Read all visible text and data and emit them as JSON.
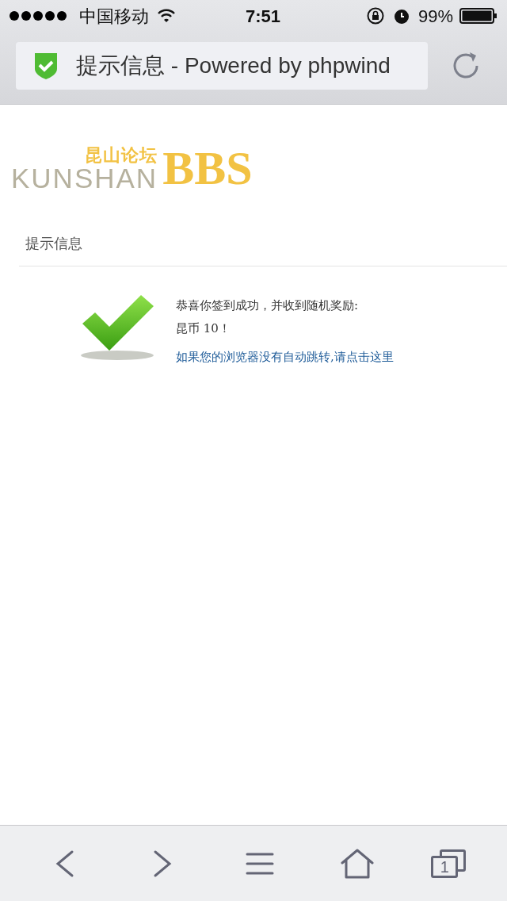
{
  "status_bar": {
    "carrier": "中国移动",
    "time": "7:51",
    "battery": "99%"
  },
  "address_bar": {
    "title": "提示信息 - Powered by phpwind"
  },
  "logo": {
    "chinese": "昆山论坛",
    "latin": "KUNSHAN",
    "mark": "BBS"
  },
  "panel": {
    "heading": "提示信息",
    "message": "恭喜你签到成功，并收到随机奖励:",
    "reward": "昆币 10！",
    "link": "如果您的浏览器没有自动跳转,请点击这里"
  },
  "toolbar": {
    "tab_count": "1"
  }
}
